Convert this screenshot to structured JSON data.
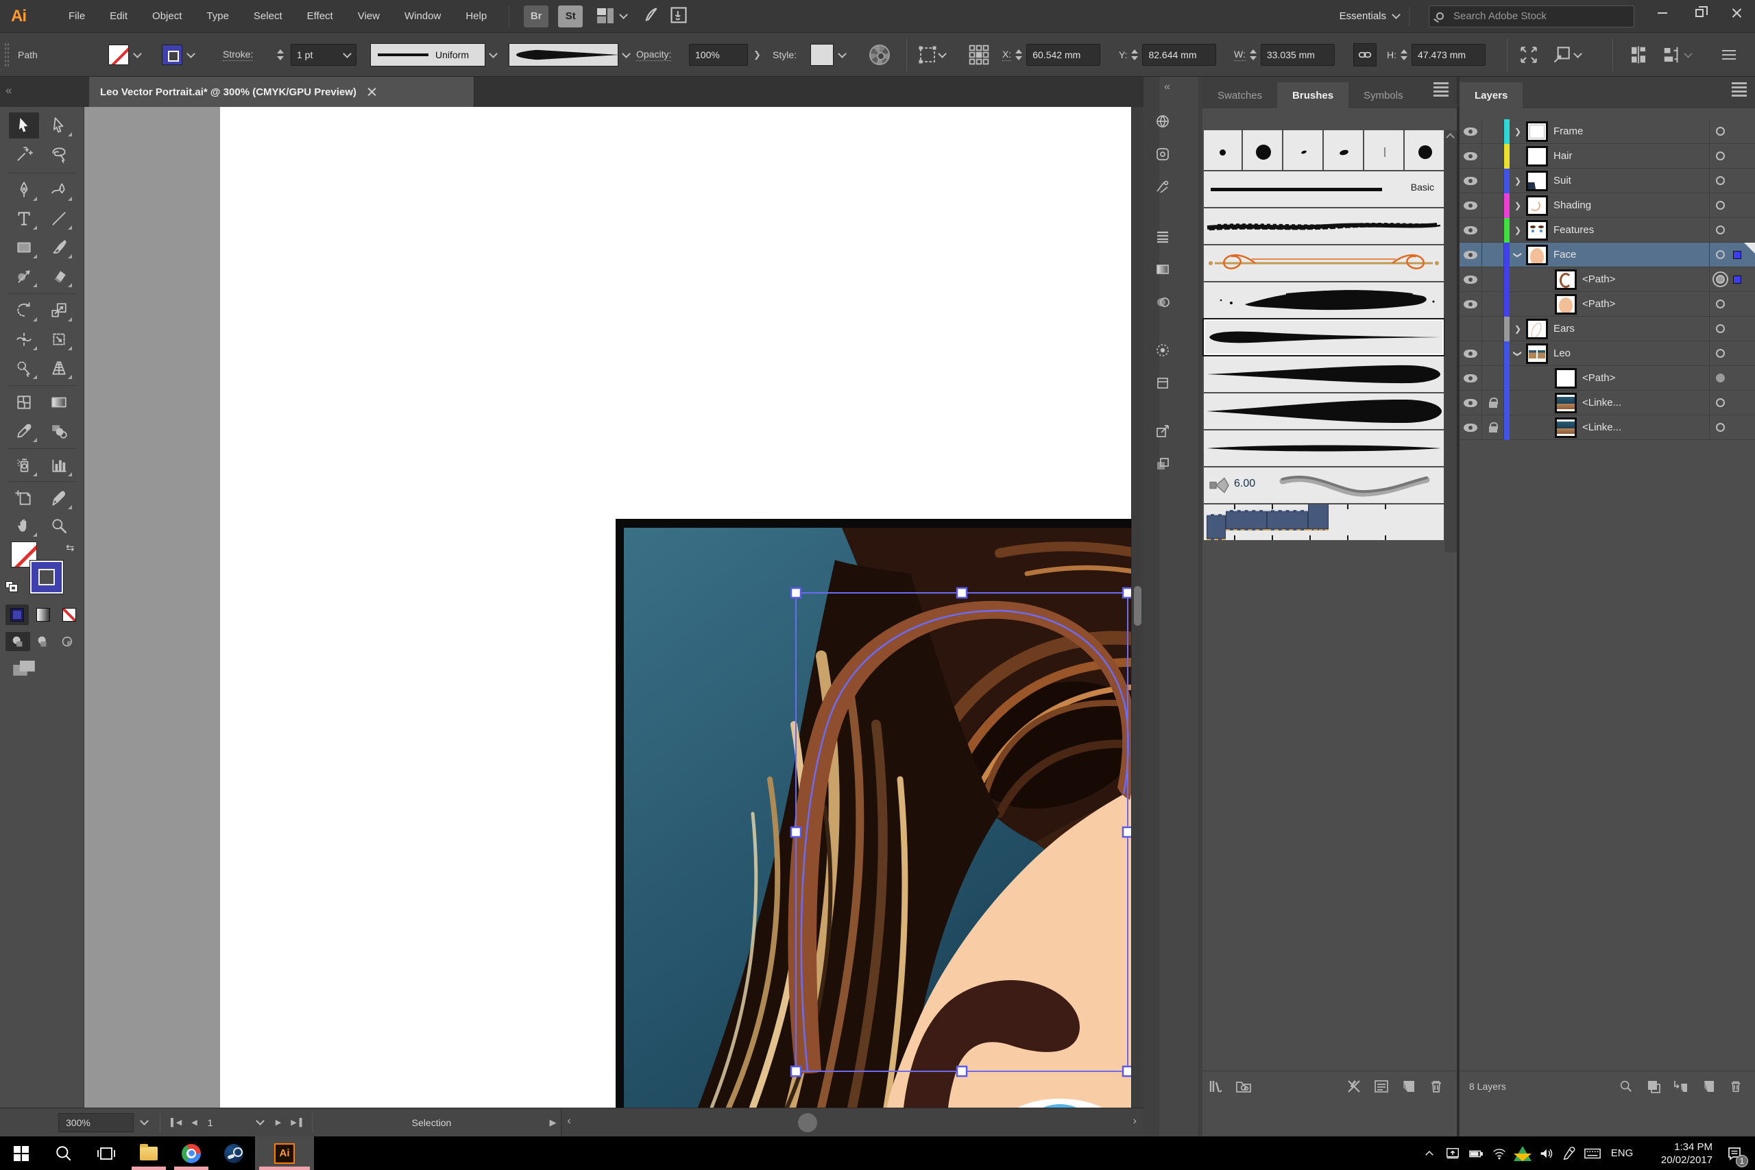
{
  "app": {
    "logo": "Ai",
    "bridge": "Br",
    "stock": "St"
  },
  "menu": {
    "items": [
      "File",
      "Edit",
      "Object",
      "Type",
      "Select",
      "Effect",
      "View",
      "Window",
      "Help"
    ]
  },
  "workspace": {
    "label": "Essentials"
  },
  "search": {
    "placeholder": "Search Adobe Stock"
  },
  "control": {
    "object_label": "Path",
    "stroke_label": "Stroke:",
    "stroke_weight": "1 pt",
    "variable_width": "Uniform",
    "opacity_label": "Opacity:",
    "opacity_value": "100%",
    "style_label": "Style:",
    "x_label": "X:",
    "x_value": "60.542 mm",
    "y_label": "Y:",
    "y_value": "82.644 mm",
    "w_label": "W:",
    "w_value": "33.035 mm",
    "h_label": "H:",
    "h_value": "47.473 mm"
  },
  "tab": {
    "title": "Leo Vector Portrait.ai* @ 300% (CMYK/GPU Preview)"
  },
  "dock_tabs": {
    "items": [
      "Swatches",
      "Brushes",
      "Symbols"
    ],
    "active": "Brushes"
  },
  "brushes": {
    "basic_label": "Basic",
    "bristle_size": "6.00",
    "rows": [
      "calligraphic-set",
      "basic",
      "charcoal",
      "arrow-decorative",
      "ink-splatter",
      "taper-left-selected",
      "taper-right",
      "taper-right-large",
      "spindle",
      "bristle",
      "denim-pattern"
    ]
  },
  "layers": {
    "title": "Layers",
    "rows": [
      {
        "name": "Frame",
        "color": "#2fd8d8",
        "visible": true,
        "expanded": false
      },
      {
        "name": "Hair",
        "color": "#e8e02a",
        "visible": true
      },
      {
        "name": "Suit",
        "color": "#4053e8",
        "visible": true,
        "expanded": false
      },
      {
        "name": "Shading",
        "color": "#ee3ed8",
        "visible": true,
        "expanded": false
      },
      {
        "name": "Features",
        "color": "#3ee03e",
        "visible": true,
        "expanded": false
      },
      {
        "name": "Face",
        "color": "#4040ee",
        "visible": true,
        "expanded": true,
        "selected": true
      },
      {
        "name": "<Path>",
        "color": "#4040ee",
        "visible": true,
        "sub": true,
        "targeted": true
      },
      {
        "name": "<Path>",
        "color": "#4040ee",
        "visible": true,
        "sub": true
      },
      {
        "name": "Ears",
        "color": "#9a9a9a",
        "visible": false,
        "expanded": false
      },
      {
        "name": "Leo",
        "color": "#4053e8",
        "visible": true,
        "expanded": true
      },
      {
        "name": "<Path>",
        "color": "#4053e8",
        "visible": true,
        "sub": true,
        "applied": true
      },
      {
        "name": "<Linke...",
        "color": "#4053e8",
        "visible": true,
        "sub": true,
        "locked": true
      },
      {
        "name": "<Linke...",
        "color": "#4053e8",
        "visible": true,
        "sub": true,
        "locked": true
      }
    ],
    "footer": "8 Layers"
  },
  "statusbar": {
    "zoom": "300%",
    "artboard": "1",
    "tool": "Selection"
  },
  "taskbar": {
    "lang": "ENG",
    "time": "1:34 PM",
    "date": "20/02/2017",
    "notifications": "1"
  },
  "colors": {
    "selection_accent": "#6b6bf3",
    "layer_highlight": "#56718d",
    "taskbar_accent": "#efa3ad",
    "trace_brown": "#8f4e2d",
    "face_skin": "#f8cda6",
    "ai_orange": "#ff9a2e"
  }
}
